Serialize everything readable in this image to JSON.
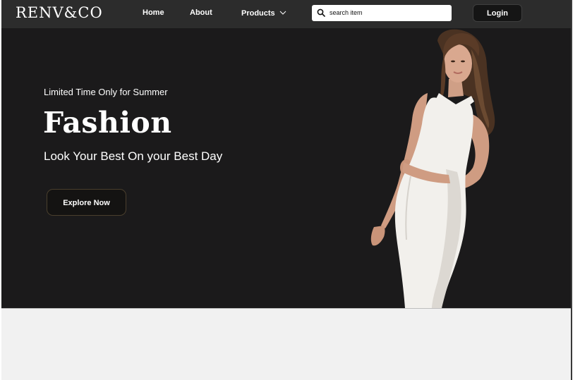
{
  "nav": {
    "logo": "RENV&CO",
    "links": [
      {
        "label": "Home"
      },
      {
        "label": "About"
      },
      {
        "label": "Products"
      }
    ],
    "search": {
      "placeholder": "search item",
      "value": ""
    },
    "login_label": "Login"
  },
  "hero": {
    "tagline": "Limited Time Only for Summer",
    "headline": "Fashion",
    "subheadline": "Look Your Best On your Best Day",
    "cta_label": "Explore Now"
  },
  "colors": {
    "navbar_bg": "#2c2c2c",
    "hero_bg": "#1b1a1b",
    "lower_bg": "#f1f1f1",
    "dress": "#f2f0ec"
  },
  "icons": [
    "search-icon",
    "chevron-down-icon"
  ]
}
